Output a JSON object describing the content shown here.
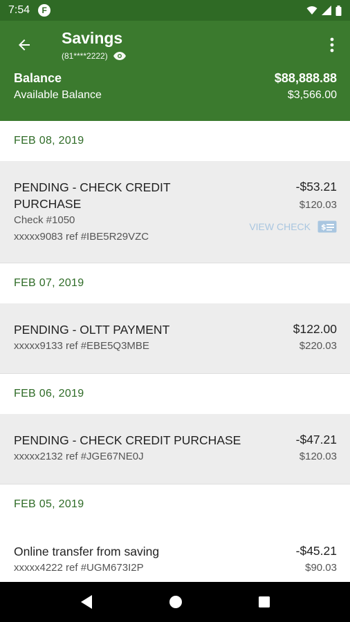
{
  "status": {
    "time": "7:54",
    "app_icon_letter": "F"
  },
  "header": {
    "title": "Savings",
    "account_masked": "(81****2222)",
    "balance_label": "Balance",
    "balance_value": "$88,888.88",
    "available_label": "Available Balance",
    "available_value": "$3,566.00"
  },
  "groups": [
    {
      "date": "FEB 08, 2019",
      "txn": {
        "desc_line1": "PENDING - CHECK CREDIT",
        "desc_line2": "PURCHASE",
        "check": "Check #1050",
        "ref": "xxxxx9083 ref #IBE5R29VZC",
        "amount": "-$53.21",
        "running_balance": "$120.03",
        "view_check_label": "VIEW CHECK"
      }
    },
    {
      "date": "FEB 07, 2019",
      "txn": {
        "desc": "PENDING - OLTT PAYMENT",
        "ref": "xxxxx9133 ref #EBE5Q3MBE",
        "amount": "$122.00",
        "running_balance": "$220.03"
      }
    },
    {
      "date": "FEB 06, 2019",
      "txn": {
        "desc": "PENDING - CHECK CREDIT PURCHASE",
        "ref": "xxxxx2132 ref #JGE67NE0J",
        "amount": "-$47.21",
        "running_balance": "$120.03"
      }
    },
    {
      "date": "FEB 05, 2019",
      "txn": {
        "desc": "Online transfer from saving",
        "ref": "xxxxx4222 ref #UGM673I2P",
        "amount": "-$45.21",
        "running_balance": "$90.03"
      }
    }
  ],
  "icons": [
    "back-arrow-icon",
    "eye-icon",
    "more-vert-icon",
    "check-icon",
    "wifi-icon",
    "signal-icon",
    "battery-icon",
    "nav-back-icon",
    "nav-home-icon",
    "nav-recents-icon"
  ],
  "colors": {
    "header_green": "#3b7a2e",
    "status_green": "#2f6a25",
    "date_green": "#2e6b26",
    "view_check_blue": "#a9c6e0"
  }
}
